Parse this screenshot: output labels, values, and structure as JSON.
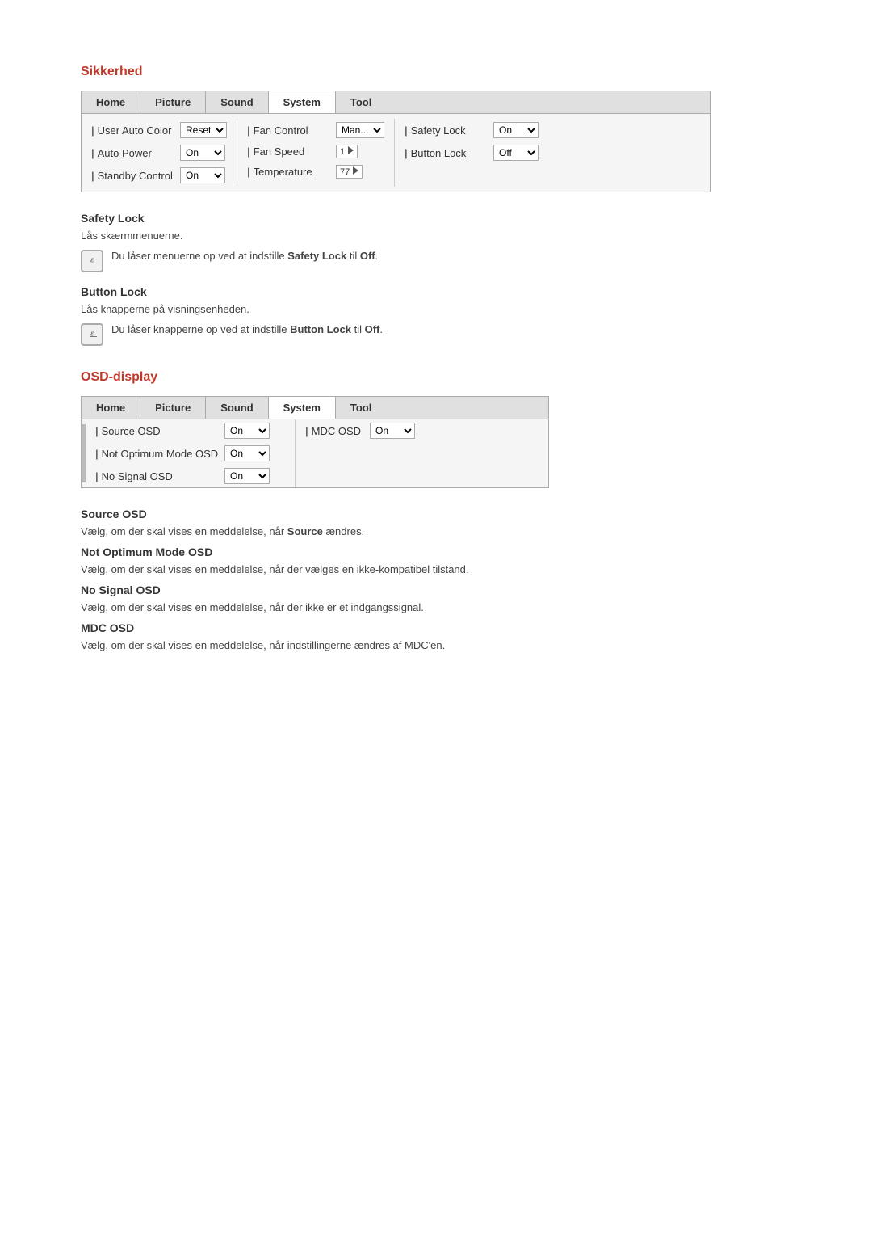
{
  "page": {
    "sections": {
      "sikkerhed": {
        "title": "Sikkerhed",
        "menu": {
          "tabs": [
            "Home",
            "Picture",
            "Sound",
            "System",
            "Tool"
          ],
          "active_tab": "System",
          "columns": [
            {
              "rows": [
                {
                  "label": "User Auto Color",
                  "control_type": "select",
                  "value": "Reset"
                },
                {
                  "label": "Auto Power",
                  "control_type": "select",
                  "value": "On"
                },
                {
                  "label": "Standby Control",
                  "control_type": "select",
                  "value": "On"
                }
              ]
            },
            {
              "rows": [
                {
                  "label": "Fan Control",
                  "control_type": "select",
                  "value": "Man..."
                },
                {
                  "label": "Fan Speed",
                  "control_type": "arrow",
                  "value": "1"
                },
                {
                  "label": "Temperature",
                  "control_type": "arrow",
                  "value": "77"
                }
              ]
            },
            {
              "rows": [
                {
                  "label": "Safety Lock",
                  "control_type": "select",
                  "value": "On"
                },
                {
                  "label": "Button Lock",
                  "control_type": "select",
                  "value": "Off"
                }
              ]
            }
          ]
        },
        "safety_lock": {
          "title": "Safety Lock",
          "text": "Lås skærmmenuerne.",
          "note": "Du låser menuerne op ved at indstille Safety Lock til Off.",
          "note_bold_before": "Du låser menuerne op ved at indstille ",
          "note_bold": "Safety Lock",
          "note_after": " til ",
          "note_bold2": "Off",
          "note_end": "."
        },
        "button_lock": {
          "title": "Button Lock",
          "text": "Lås knapperne på visningsenheden.",
          "note_bold_before": "Du låser knapperne op ved at indstille ",
          "note_bold": "Button Lock",
          "note_after": " til ",
          "note_bold2": "Off",
          "note_end": "."
        }
      },
      "osd_display": {
        "title": "OSD-display",
        "menu": {
          "tabs": [
            "Home",
            "Picture",
            "Sound",
            "System",
            "Tool"
          ],
          "active_tab": "System",
          "left_col": [
            {
              "label": "Source OSD",
              "control_type": "select",
              "value": "On"
            },
            {
              "label": "Not Optimum Mode OSD",
              "control_type": "select",
              "value": "On"
            },
            {
              "label": "No Signal OSD",
              "control_type": "select",
              "value": "On"
            }
          ],
          "right_col": [
            {
              "label": "MDC OSD",
              "control_type": "select",
              "value": "On"
            }
          ]
        },
        "source_osd": {
          "title": "Source OSD",
          "text_before": "Vælg, om der skal vises en meddelelse, når ",
          "text_bold": "Source",
          "text_after": " ændres."
        },
        "not_optimum": {
          "title": "Not Optimum Mode OSD",
          "text": "Vælg, om der skal vises en meddelelse, når der vælges en ikke-kompatibel tilstand."
        },
        "no_signal": {
          "title": "No Signal OSD",
          "text": "Vælg, om der skal vises en meddelelse, når der ikke er et indgangssignal."
        },
        "mdc_osd": {
          "title": "MDC OSD",
          "text": "Vælg, om der skal vises en meddelelse, når indstillingerne ændres af MDC'en."
        }
      }
    }
  }
}
